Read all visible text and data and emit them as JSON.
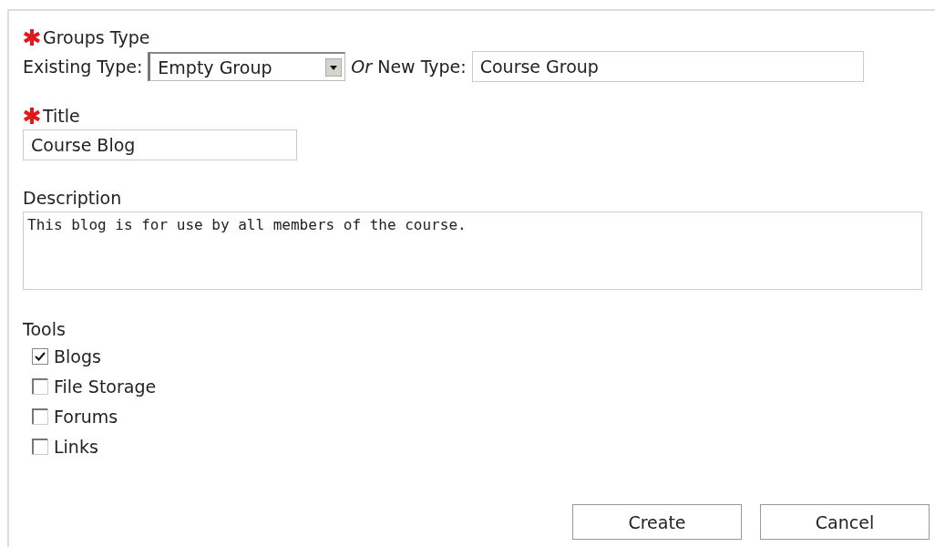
{
  "groups_type": {
    "label": "Groups Type",
    "required": true,
    "existing_label": "Existing Type:",
    "existing_value": "Empty Group",
    "or_label": "Or",
    "new_label": "New Type:",
    "new_value": "Course Group"
  },
  "title": {
    "label": "Title",
    "required": true,
    "value": "Course Blog"
  },
  "description": {
    "label": "Description",
    "value": "This blog is for use by all members of the course."
  },
  "tools": {
    "label": "Tools",
    "items": [
      {
        "label": "Blogs",
        "checked": true
      },
      {
        "label": "File Storage",
        "checked": false
      },
      {
        "label": "Forums",
        "checked": false
      },
      {
        "label": "Links",
        "checked": false
      }
    ]
  },
  "buttons": [
    "Create",
    "Cancel"
  ]
}
